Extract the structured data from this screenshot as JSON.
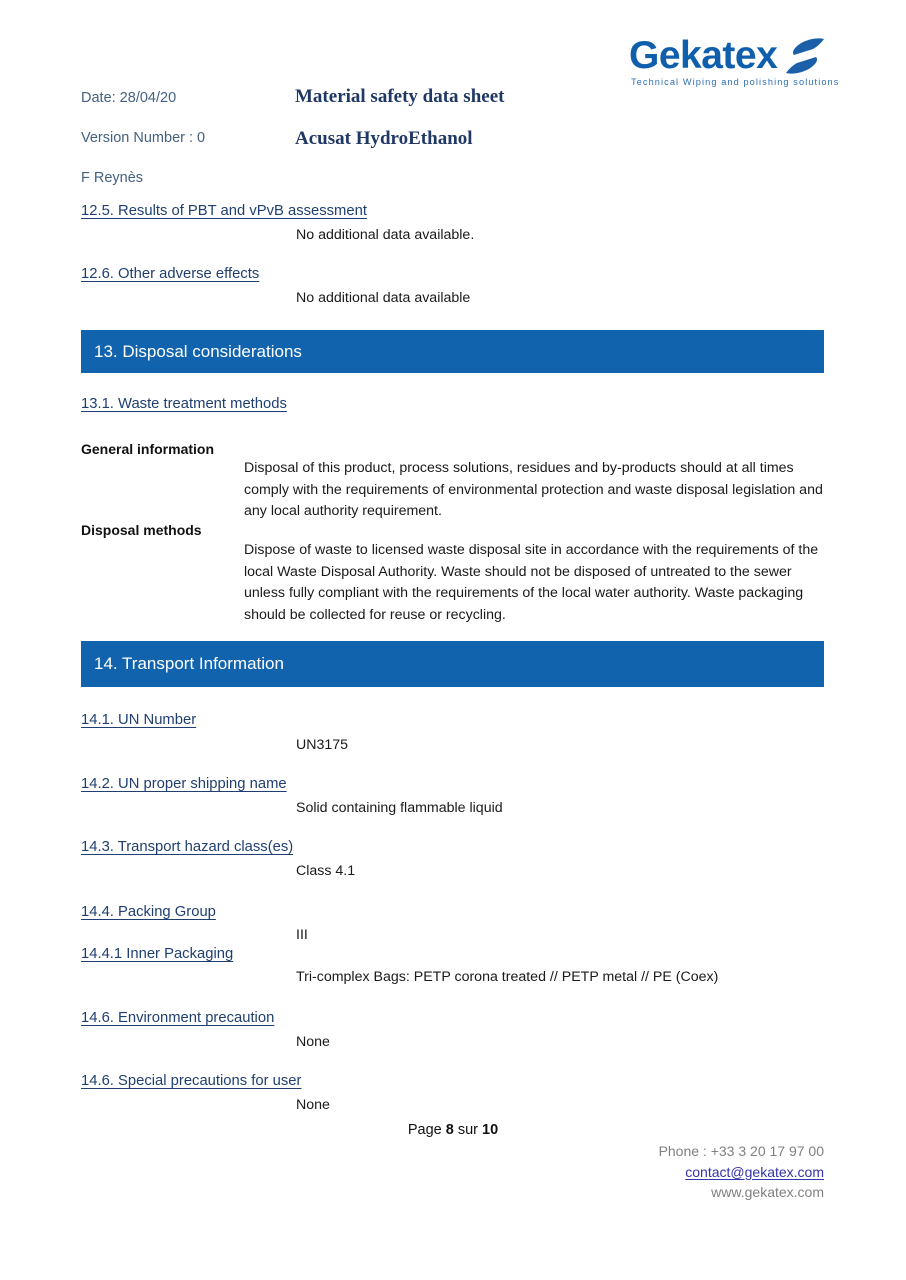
{
  "document": {
    "header": {
      "date_label": "Date: 28/04/20",
      "version_label": "Version Number : 0",
      "author": "F Reynès",
      "title": "Material safety data sheet",
      "product": "Acusat HydroEthanol"
    },
    "logo": {
      "wordmark": "Gekatex",
      "tagline": "Technical Wiping and polishing solutions",
      "swoosh_icon": "gekatex-swoosh-icon",
      "color": "#0f5fad"
    },
    "sections": {
      "s12_5": {
        "heading": "12.5. Results of PBT and vPvB assessment",
        "body": "No additional data available."
      },
      "s12_6": {
        "heading": "12.6. Other adverse effects",
        "body": "No additional data available"
      },
      "band13": "13. Disposal considerations",
      "s13_1": {
        "heading": "13.1. Waste treatment methods",
        "label_general": "General information",
        "text_general": "Disposal of this product, process solutions, residues and by-products should at all times comply with the requirements of environmental protection and waste disposal legislation and any local authority requirement.",
        "label_disposal": "Disposal methods",
        "text_disposal": "Dispose of waste to licensed waste disposal site in accordance with the requirements of the local Waste Disposal Authority. Waste should not be disposed of untreated to the sewer unless fully compliant with the requirements of the local water authority. Waste packaging should be collected for reuse or recycling."
      },
      "band14": "14. Transport Information",
      "s14_1": {
        "heading": "14.1. UN Number",
        "body": "UN3175"
      },
      "s14_2": {
        "heading": "14.2. UN proper shipping name",
        "body": "Solid containing flammable liquid"
      },
      "s14_3": {
        "heading": "14.3. Transport hazard class(es)",
        "body": "Class 4.1"
      },
      "s14_4": {
        "heading": "14.4. Packing Group",
        "body": "III"
      },
      "s14_4_1": {
        "heading": "14.4.1 Inner Packaging",
        "body": "Tri-complex Bags: PETP corona treated // PETP metal // PE (Coex)"
      },
      "s14_6a": {
        "heading": "14.6. Environment precaution",
        "body": "None"
      },
      "s14_6b": {
        "heading": "14.6. Special precautions for user",
        "body": "None"
      }
    },
    "footer": {
      "page_prefix": "Page ",
      "page_current": "8",
      "page_middle": " sur ",
      "page_total": "10",
      "phone": "Phone : +33 3 20 17 97 00",
      "email": "contact@gekatex.com",
      "website": "www.gekatex.com"
    },
    "colors": {
      "band_blue": "#1263ae",
      "heading_blue": "#1f3f70",
      "title_navy": "#1f3864",
      "header_slate": "#44617f",
      "link_purple": "#3333aa"
    }
  }
}
